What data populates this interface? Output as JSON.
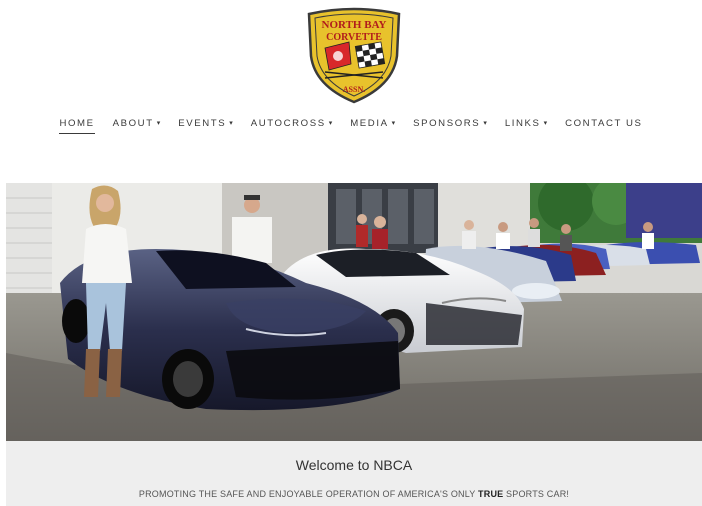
{
  "logo": {
    "line1": "NORTH BAY",
    "line2": "CORVETTE",
    "line3": "ASSN.",
    "colors": {
      "shield": "#e8c22c",
      "border": "#3a3a3a",
      "flag_red": "#d8282a"
    }
  },
  "nav": {
    "items": [
      {
        "label": "HOME",
        "dropdown": false,
        "active": true
      },
      {
        "label": "ABOUT",
        "dropdown": true
      },
      {
        "label": "EVENTS",
        "dropdown": true
      },
      {
        "label": "AUTOCROSS",
        "dropdown": true
      },
      {
        "label": "MEDIA",
        "dropdown": true
      },
      {
        "label": "SPONSORS",
        "dropdown": true
      },
      {
        "label": "LINKS",
        "dropdown": true
      },
      {
        "label": "CONTACT US",
        "dropdown": false
      }
    ],
    "caret": "▾"
  },
  "welcome": {
    "title": "Welcome to NBCA",
    "subtitle_before": "PROMOTING THE SAFE AND ENJOYABLE OPERATION OF AMERICA'S ONLY ",
    "subtitle_bold": "TRUE",
    "subtitle_after": " SPORTS CAR!"
  }
}
